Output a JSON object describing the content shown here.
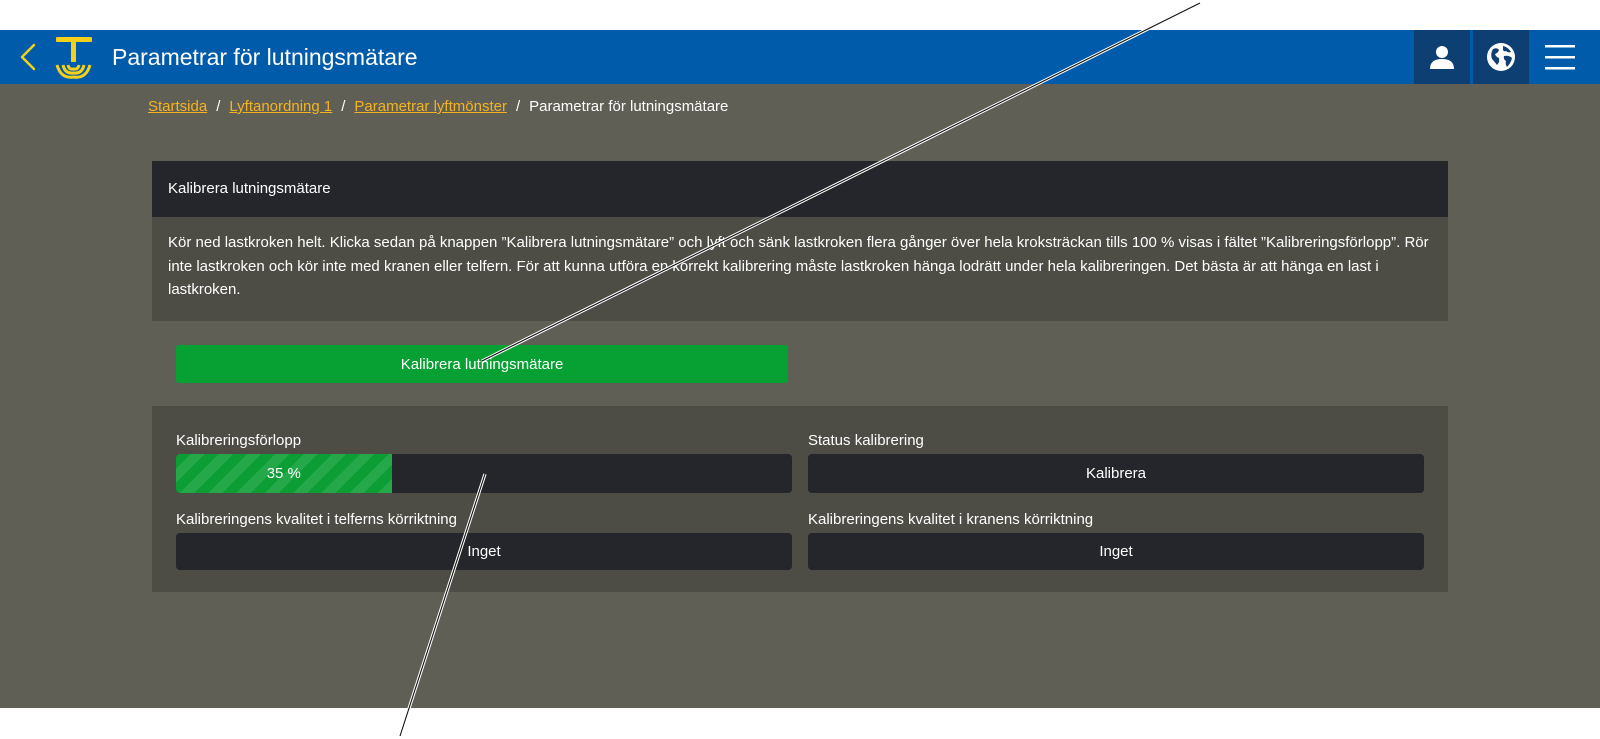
{
  "header": {
    "title": "Parametrar för lutningsmätare",
    "bg_color": "#005baa",
    "accent_color": "#f4d01a",
    "icons": [
      "chevron-left-icon",
      "crane-hook-logo",
      "user-icon",
      "globe-icon",
      "hamburger-menu-icon"
    ]
  },
  "breadcrumb": {
    "items": [
      "Startsida",
      "Lyftanordning 1",
      "Parametrar lyftmönster"
    ],
    "current": "Parametrar för lutningsmätare",
    "separator": "/",
    "link_color": "#f6b321"
  },
  "calibration_card": {
    "title": "Kalibrera lutningsmätare",
    "instructions": "Kör ned lastkroken helt. Klicka sedan på knappen ”Kalibrera lutningsmätare” och lyft och sänk lastkroken flera gånger över hela kroksträckan tills 100 % visas i fältet ”Kalibreringsförlopp”. Rör inte lastkroken och kör inte med kranen eller telfern. För att kunna utföra en korrekt kalibrering måste lastkroken hänga lodrätt under hela kalibreringen. Det bästa är att hänga en last i lastkroken.",
    "button_label": "Kalibrera lutningsmätare",
    "button_color": "#07a133"
  },
  "status_panel": {
    "progress_label": "Kalibreringsförlopp",
    "progress_value": 35,
    "progress_text": "35 %",
    "status_label": "Status kalibrering",
    "status_value": "Kalibrera",
    "hoist_quality_label": "Kalibreringens kvalitet i telferns körriktning",
    "hoist_quality_value": "Inget",
    "crane_quality_label": "Kalibreringens kvalitet i kranens körriktning",
    "crane_quality_value": "Inget"
  }
}
